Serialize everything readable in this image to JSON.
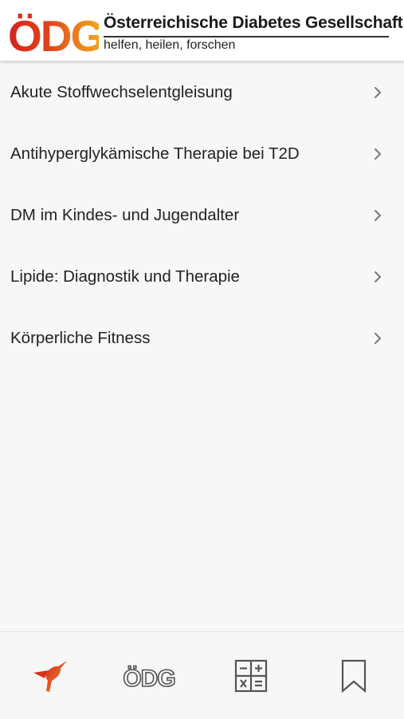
{
  "header": {
    "logo_text": "ÖDG",
    "org_name": "Österreichische Diabetes Gesellschaft",
    "tagline": "helfen, heilen, forschen"
  },
  "menu": {
    "items": [
      {
        "label": "Akute Stoffwechselentgleisung"
      },
      {
        "label": "Antihyperglykämische Therapie bei T2D"
      },
      {
        "label": "DM im Kindes- und Jugendalter"
      },
      {
        "label": "Lipide: Diagnostik und Therapie"
      },
      {
        "label": "Körperliche Fitness"
      }
    ],
    "chevron_icon": "chevron-right-icon"
  },
  "bottom_nav": {
    "items": [
      {
        "icon": "hummingbird-icon",
        "active": true
      },
      {
        "icon": "oedg-logo-icon",
        "text": "ÖDG",
        "active": false
      },
      {
        "icon": "calculator-icon",
        "active": false
      },
      {
        "icon": "bookmark-icon",
        "active": false
      }
    ]
  },
  "colors": {
    "logo_red": "#d4231b",
    "logo_orange": "#ea7a1e",
    "logo_yellow": "#f4a81c",
    "active_accent": "#e4592a",
    "icon_gray": "#555555",
    "chevron_gray": "#777777",
    "background": "#f7f7f7"
  }
}
